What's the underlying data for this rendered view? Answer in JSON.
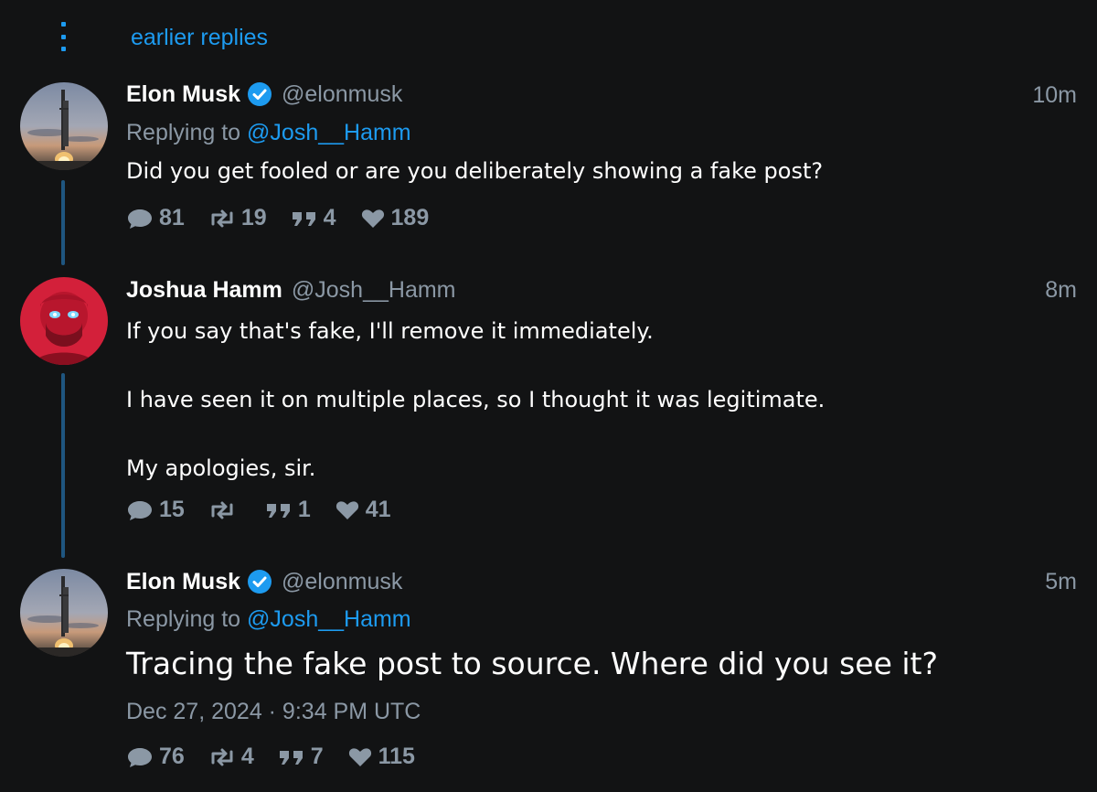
{
  "thread": {
    "earlier_replies_label": "earlier replies"
  },
  "colors": {
    "background": "#121314",
    "accent": "#1d9bf0",
    "muted": "#8b98a5",
    "text": "#ffffff",
    "thread_line": "#1f5680"
  },
  "posts": [
    {
      "name": "Elon Musk",
      "verified": true,
      "handle": "@elonmusk",
      "time": "10m",
      "replying_prefix": "Replying to ",
      "replying_to": "@Josh__Hamm",
      "text": "Did you get fooled or are you deliberately showing a fake post?",
      "stats": {
        "replies": "81",
        "reposts": "19",
        "quotes": "4",
        "likes": "189"
      },
      "avatar_icon": "rocket-launch-photo"
    },
    {
      "name": "Joshua Hamm",
      "verified": false,
      "handle": "@Josh__Hamm",
      "time": "8m",
      "text": "If you say that's fake, I'll remove it immediately.\n\nI have seen it on multiple places, so I thought it was legitimate.\n\nMy apologies, sir.",
      "stats": {
        "replies": "15",
        "reposts": "",
        "quotes": "1",
        "likes": "41"
      },
      "avatar_icon": "red-laser-eyes-portrait"
    },
    {
      "name": "Elon Musk",
      "verified": true,
      "handle": "@elonmusk",
      "time": "5m",
      "replying_prefix": "Replying to ",
      "replying_to": "@Josh__Hamm",
      "text": "Tracing the fake post to source. Where did you see it?",
      "date": "Dec 27, 2024 · 9:34 PM UTC",
      "stats": {
        "replies": "76",
        "reposts": "4",
        "quotes": "7",
        "likes": "115"
      },
      "avatar_icon": "rocket-launch-photo"
    }
  ]
}
